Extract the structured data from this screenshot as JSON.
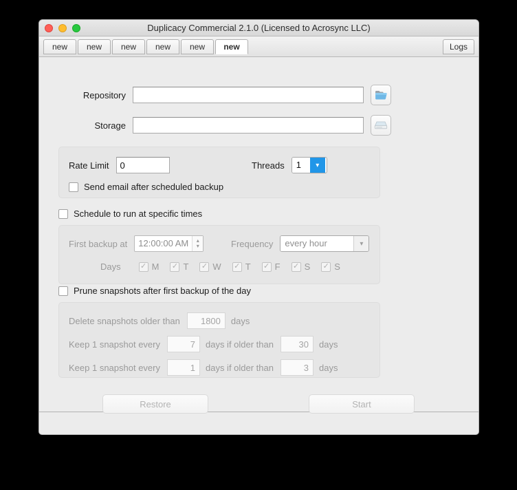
{
  "window": {
    "title": "Duplicacy Commercial 2.1.0 (Licensed to Acrosync LLC)"
  },
  "tabs": {
    "items": [
      {
        "label": "new",
        "active": false
      },
      {
        "label": "new",
        "active": false
      },
      {
        "label": "new",
        "active": false
      },
      {
        "label": "new",
        "active": false
      },
      {
        "label": "new",
        "active": false
      },
      {
        "label": "new",
        "active": true
      }
    ],
    "logs_label": "Logs"
  },
  "form": {
    "repository_label": "Repository",
    "repository_value": "",
    "repository_placeholder": "",
    "repository_browse_icon": "folder-icon",
    "storage_label": "Storage",
    "storage_value": "",
    "storage_placeholder": "",
    "storage_browse_icon": "disk-drive-icon"
  },
  "options": {
    "rate_limit_label": "Rate Limit",
    "rate_limit_value": "0",
    "threads_label": "Threads",
    "threads_value": "1",
    "threads_chevron_icon": "chevron-down-icon",
    "send_email_label": "Send email after scheduled backup",
    "send_email_checked": false
  },
  "schedule": {
    "enable_label": "Schedule to run at specific times",
    "enable_checked": false,
    "first_backup_label": "First backup at",
    "first_backup_value": "12:00:00 AM",
    "stepper_icon": "spinner-arrows-icon",
    "frequency_label": "Frequency",
    "frequency_value": "every hour",
    "frequency_chevron_icon": "chevron-down-icon",
    "days_label": "Days",
    "days": [
      {
        "label": "M",
        "checked": true
      },
      {
        "label": "T",
        "checked": true
      },
      {
        "label": "W",
        "checked": true
      },
      {
        "label": "T",
        "checked": true
      },
      {
        "label": "F",
        "checked": true
      },
      {
        "label": "S",
        "checked": true
      },
      {
        "label": "S",
        "checked": true
      }
    ]
  },
  "prune": {
    "enable_label": "Prune snapshots after first backup of the day",
    "enable_checked": false,
    "delete_label": "Delete snapshots older than",
    "delete_value": "1800",
    "delete_unit": "days",
    "rule1_prefix": "Keep 1 snapshot every",
    "rule1_every": "7",
    "rule1_middle": "days if older than",
    "rule1_older": "30",
    "rule1_unit": "days",
    "rule2_prefix": "Keep 1 snapshot every",
    "rule2_every": "1",
    "rule2_middle": "days if older than",
    "rule2_older": "3",
    "rule2_unit": "days"
  },
  "actions": {
    "restore_label": "Restore",
    "start_label": "Start"
  },
  "colors": {
    "accent_blue": "#2196e8",
    "window_bg": "#ececec",
    "panel_bg": "#e6e6e6",
    "disabled_text": "#9a9a9a"
  }
}
